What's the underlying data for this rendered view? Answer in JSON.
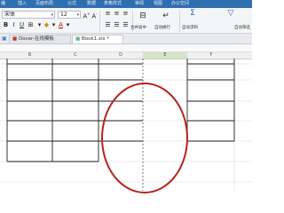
{
  "menu": {
    "items": [
      "插入",
      "页面布局",
      "公式",
      "数据",
      "表格样式",
      "审阅",
      "视图",
      "办公空间"
    ],
    "partial_left": "编"
  },
  "toolbar": {
    "font_name": "宋体",
    "font_size": "12",
    "bold": "B",
    "italic": "I",
    "underline": "U",
    "font_color_letter": "A",
    "merge_label": "合并居中",
    "wrap_label": "自动换行",
    "autosum_label": "自动求和",
    "autofilter_label": "自动筛选"
  },
  "tabs": [
    {
      "label": "Docer-在线模板",
      "active": false
    },
    {
      "label": "Book1.xls *",
      "active": true
    }
  ],
  "columns": [
    "B",
    "C",
    "D",
    "E",
    "F"
  ],
  "colors": {
    "menubar": "#2f6fb0",
    "annotation": "#b5231f",
    "grid": "#1e1e1e"
  }
}
